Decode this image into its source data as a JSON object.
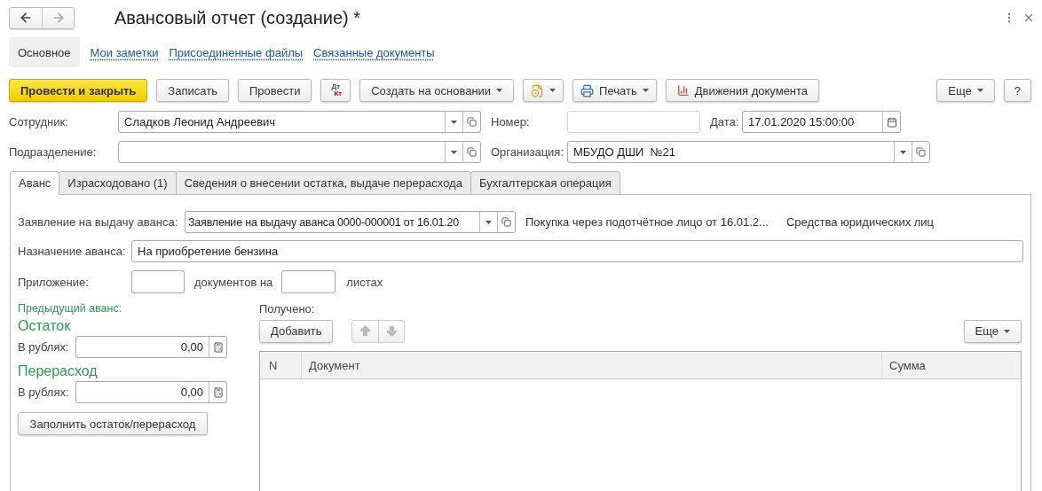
{
  "window": {
    "title": "Авансовый отчет (создание) *"
  },
  "nav": [
    {
      "kind": "back",
      "disabled": false
    },
    {
      "kind": "forward",
      "disabled": true
    }
  ],
  "sections": [
    {
      "label": "Основное",
      "selected": true
    },
    {
      "label": "Мои заметки",
      "selected": false
    },
    {
      "label": "Присоединенные файлы",
      "selected": false
    },
    {
      "label": "Связанные документы",
      "selected": false
    }
  ],
  "toolbar": {
    "left": [
      {
        "kind": "primary",
        "label": "Провести и закрыть"
      },
      {
        "kind": "plain",
        "label": "Записать"
      },
      {
        "kind": "plain",
        "label": "Провести"
      },
      {
        "kind": "dtkt",
        "debit": "Дт",
        "credit": "Кт"
      },
      {
        "kind": "menu",
        "label": "Создать на основании"
      },
      {
        "kind": "iconmenu"
      },
      {
        "kind": "print",
        "label": "Печать"
      },
      {
        "kind": "report",
        "label": "Движения документа"
      }
    ],
    "right": [
      {
        "kind": "menu",
        "label": "Еще"
      },
      {
        "kind": "plain",
        "label": "?"
      }
    ]
  },
  "employee": {
    "label": "Сотрудник:",
    "value": "Сладков Леонид Андреевич"
  },
  "number": {
    "label": "Номер:"
  },
  "date": {
    "label": "Дата:",
    "value": "17.01.2020 15:00:00"
  },
  "department": {
    "label": "Подразделение:"
  },
  "organization": {
    "label": "Организация:",
    "value": "МБУДО ДШИ  №21"
  },
  "tabs": [
    {
      "label": "Аванс",
      "selected": true
    },
    {
      "label": "Израсходовано (1)",
      "selected": false
    },
    {
      "label": "Сведения о внесении остатка, выдаче перерасхода",
      "selected": false
    },
    {
      "label": "Бухгалтерская операция",
      "selected": false
    }
  ],
  "advance": {
    "application": {
      "label": "Заявление на выдачу аванса:",
      "value": "Заявление на выдачу аванса 0000-000001 от 16.01.20",
      "info": [
        "Покупка через подотчётное лицо от 16.01.2...",
        "Средства юридических лиц"
      ]
    },
    "purpose": {
      "label": "Назначение аванса:",
      "value": "На приобретение бензина"
    },
    "attachment": {
      "label": "Приложение:",
      "middle": "документов на",
      "suffix": "листах"
    },
    "previous": {
      "title": "Предыдущий аванс:",
      "groups": [
        {
          "title": "Остаток",
          "label": "В рублях:",
          "value": "0,00"
        },
        {
          "title": "Перерасход",
          "label": "В рублях:",
          "value": "0,00"
        }
      ],
      "fill_button": "Заполнить остаток/перерасход"
    },
    "received": {
      "label": "Получено:",
      "add_button": "Добавить",
      "more_button": "Еще",
      "columns": [
        "N",
        "Документ",
        "Сумма"
      ]
    }
  }
}
